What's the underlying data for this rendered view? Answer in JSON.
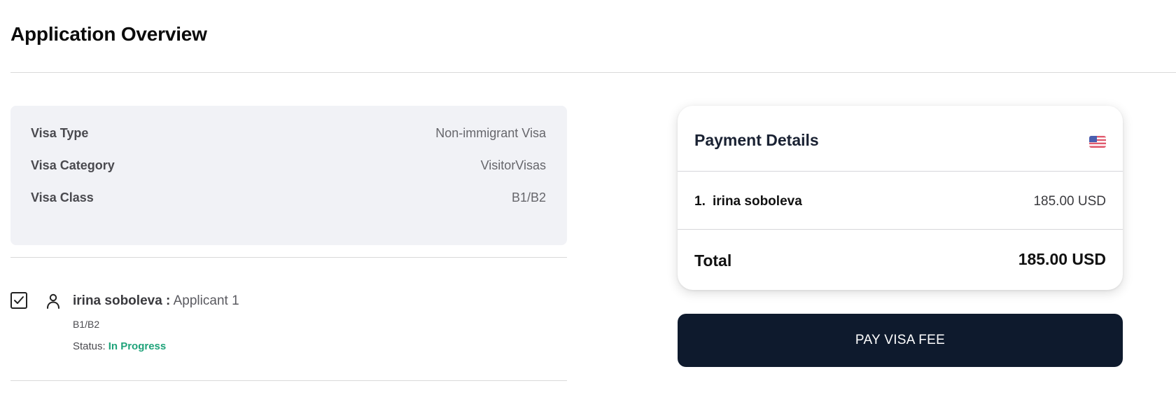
{
  "page": {
    "title": "Application Overview"
  },
  "visa": {
    "rows": [
      {
        "label": "Visa Type",
        "value": "Non-immigrant Visa"
      },
      {
        "label": "Visa Category",
        "value": "VisitorVisas"
      },
      {
        "label": "Visa Class",
        "value": "B1/B2"
      }
    ]
  },
  "applicant": {
    "name": "irina soboleva",
    "separator": " :",
    "role": "Applicant 1",
    "visa_class": "B1/B2",
    "status_label": "Status:",
    "status_value": "In Progress",
    "checked": true,
    "icons": {
      "checkbox": "check-icon",
      "person": "person-icon"
    }
  },
  "payment": {
    "title": "Payment Details",
    "flag_icon": "us-flag-icon",
    "items": [
      {
        "index": "1.",
        "name": "irina soboleva",
        "amount": "185.00 USD"
      }
    ],
    "total_label": "Total",
    "total_amount": "185.00 USD",
    "pay_button_label": "PAY VISA FEE"
  },
  "colors": {
    "status_green": "#1fa37a",
    "button_navy": "#0e1a2d",
    "card_gray": "#f1f2f6"
  }
}
